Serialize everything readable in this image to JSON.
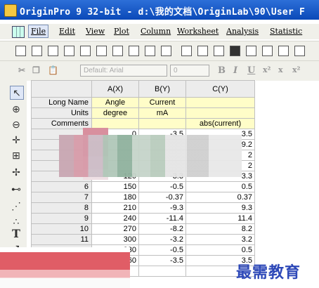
{
  "window": {
    "title": "OriginPro 9 32-bit - d:\\我的文档\\OriginLab\\90\\User F"
  },
  "menu": [
    "File",
    "Edit",
    "View",
    "Plot",
    "Column",
    "Worksheet",
    "Analysis",
    "Statistic"
  ],
  "format_toolbar": {
    "font_name": "Default: Arial",
    "font_size": "0",
    "bold": "B",
    "italic": "I",
    "underline": "U",
    "superscript": "x²",
    "subscript": "x",
    "supersub": "x²"
  },
  "sheet": {
    "columns": [
      "A(X)",
      "B(Y)",
      "C(Y)"
    ],
    "meta_rows": [
      {
        "label": "Long Name",
        "values": [
          "Angle",
          "Current",
          ""
        ]
      },
      {
        "label": "Units",
        "values": [
          "degree",
          "mA",
          ""
        ]
      },
      {
        "label": "Comments",
        "values": [
          "",
          "",
          "abs(current)"
        ]
      }
    ],
    "rows": [
      {
        "n": "",
        "a": "0",
        "b": "-3.5",
        "c": "3.5"
      },
      {
        "n": "",
        "a": "",
        "b": "",
        "c": "9.2"
      },
      {
        "n": "",
        "a": "",
        "b": "",
        "c": "2"
      },
      {
        "n": "",
        "a": "",
        "b": "",
        "c": "2"
      },
      {
        "n": "5",
        "a": "120",
        "b": "-3.3",
        "c": "3.3"
      },
      {
        "n": "6",
        "a": "150",
        "b": "-0.5",
        "c": "0.5"
      },
      {
        "n": "7",
        "a": "180",
        "b": "-0.37",
        "c": "0.37"
      },
      {
        "n": "8",
        "a": "210",
        "b": "-9.3",
        "c": "9.3"
      },
      {
        "n": "9",
        "a": "240",
        "b": "-11.4",
        "c": "11.4"
      },
      {
        "n": "10",
        "a": "270",
        "b": "-8.2",
        "c": "8.2"
      },
      {
        "n": "11",
        "a": "300",
        "b": "-3.2",
        "c": "3.2"
      },
      {
        "n": "",
        "a": "330",
        "b": "-0.5",
        "c": "0.5"
      },
      {
        "n": "",
        "a": "360",
        "b": "-3.5",
        "c": "3.5"
      },
      {
        "n": "14",
        "a": "",
        "b": "",
        "c": ""
      }
    ]
  },
  "watermark": "最需教育"
}
